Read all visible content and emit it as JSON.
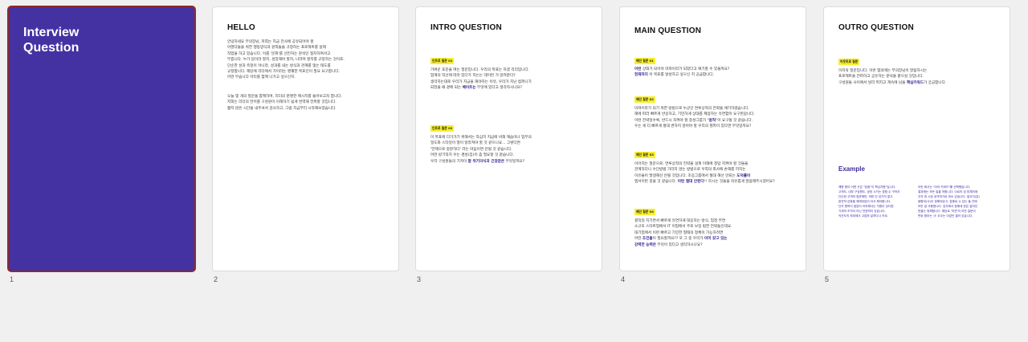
{
  "slides": [
    {
      "number": "1",
      "title_lines": [
        "Interview",
        "Question"
      ]
    },
    {
      "number": "2",
      "title": "HELLO",
      "para1": "안녕하세요 부의장님, 저희는 지금 전사에 공유되어야 할\n아젠다들을 위한 행동양식과 원칙들을 규정하는 프로젝트를 실제\n작업을 하고 있습니다. 이를 '문화'를 선언하는 분석인 접지하여서고\n부릅니다. 누가 답이라 할지, 성장해야 할지, 나라며 할지를 규정하는 것이죠.\n단순한 성과 측정이 아니라, 성과를 내는 방식과 관계를 맺는 태도를\n규정합니다. 해당에 리더에서 가이라는 명쾌한 목표인이 필요 요구합니다.\n어떤 무습니다 아티를 함께 나가고 싶으신지.",
      "para2": "오늘 몇 개의 질문을 함께하며, 리더의 분명한 메시지를 들어보고자 합니다.\n저희는 리더의 언어를 구성원이 이해하기 쉽게 번역해 전파할 것입니다.\n짧지 않은 시간을 내주셔서 감사하고, 그럼 지금부터 시작해보겠습니다."
    },
    {
      "number": "3",
      "title": "INTRO QUESTION",
      "q1_badge": "인트로 질문 01",
      "q1_text_a": "가벼운 포문을 여는 질문입니다. 우리의 목표는 하겠 리더입니다.\n업계의 익선에 따라 있다가 지는는 데이런 거 알려준다?\n생각하는대로 우리가 지금을 해야하는 이유, 우리가 지난 컴퍼니가\n되었을 때 곁에 되는 ",
      "q1_hl": "페이트는",
      "q1_text_b": " 무엇에 있다고 생각하시나요?",
      "q2_badge": "인트로 질문 02",
      "q2_text_a": "이 목표에 다가가기 위해서는 작심히 지금에 비해 해습이나 업무의\n밀도와 스타일이 많이 달라져야 할 것 같으니요... 그렇다면\n'언제으로 중분하다' 라는 마음이면 안될 것 같습니다.\n어떤 방기익지 우는 경성(집)이 좀 필요할 것 같습니다.\n우리 구성원들의 기저이 ",
      "q2_hl": "잘 위기의식과 긴장감은",
      "q2_text_b": " 무엇일까요?"
    },
    {
      "number": "4",
      "title": "MAIN QUESTION",
      "badges": [
        "메인 질문 01",
        "메인 질문 02",
        "메인 질문 03",
        "메인 질문 04"
      ],
      "m1_hl1": "이런",
      "m1_text_a": " 상태가 되어야 미쳐이라가 되었다고 얘기할 수 있을까요?\n",
      "m1_hl2": "현재까지",
      "m1_text_b": " 이 목표를 달성하고 싶으신 지 공급합니다.",
      "m2_text_a": "미쳐이라가 되기 위한 방법으로 누군인 연루상적의 전략을 얘기하셨습니다.\n해에 따라 빠르게 반응하고, 기민하게 상대를 제압하는 유연함이 요구된답니다.\n이런 전략일수록, 반드시 자켜야 할 중성그룹가 \"",
      "m2_hl": "원칙",
      "m2_text_b": "\"이 요구될 것 같습니다.\n우는 게 더 빠르게 절대 변하지 않아야 할 우리의 철학이 있다면 무엇일까요?",
      "m3_text_a": "이어지는 질문으로, 연루상적의 전략을 설계 이해에 정답 지켜야 할 것들을\n관계하다니 수단방법 가리지 않는 방법으로 우희의 회사에 손해를 끼치는\n이유들이 발생해선 안될 것입니다. 조응그룹에서 절대 해선 안되는 ",
      "m3_hl1": "도덕률이",
      "m3_text_b": "\n엠서이런 중을 것 같습니다. ",
      "m3_hl2": "이런 절대 안된다",
      "m3_text_c": "!! 하시는 것들을 자유롭게 말씀해주시겠어요?",
      "m4_text_a": "결직일 지기면서 빠르게 유연하게 대응하는 방식, 엄정 부연\n소규모 스타트업에서 IT 이업에서 주로 보일 법한 전략들인데요.\n대기업에서 이런 빠르고 기민한 형태의 정체이 가능하려면\n어떤 ",
      "m4_hl1": "조건들",
      "m4_text_b": "이 필요할까요?? 또 그 중 우리가 ",
      "m4_hl2": "이미 갖고 있는\n강력한 능력은",
      "m4_text_c": " 무엇이 있다고 생각하시나요?"
    },
    {
      "number": "5",
      "title": "OUTRO QUESTION",
      "badge": "아웃트로 질문",
      "o_text_a": "이지막 질문입니다. 이번 협의에는 부의장님이 말씀하시는\n프로젝트을 전파하고 공유하는 분석을 맡으실 것입니다.\n구성원들 사이에서 널리 퍼지고 계속에 남을 ",
      "o_hl": "핵심키워드",
      "o_text_b": "가 궁금합니다.",
      "example_title": "Example",
      "example_left": "예원 함이 어쩐 곳은 \"집중\"이 핵심지원\"입니다.\n고객도, 내부 구성원도, 공정 시키는 경험 수 구하조\n단순한 고객의 립문에만, 하한 단 담가자 알고\n완전적 감동을 해제되었어 라서 해야합니다.\n단지 협력이 많았어 이어해서는 지원이 당다편\n기계의 조직이 아닌 전장력이 있습니다.\n직관도의 최대에서 고집하 달까다나 카요.",
      "example_right": "이런 회사는 \"아라 키워드\"를 선택했습니다.\n결과에는 모든 일을 허합니다. 이르의 된 방체처에\n숫자 위 시장 공격하기로 위소 있습니다. 일무지(분)\n융합되(사)이 정해야었고, 접종로 수 있는 둘 관에\n모든 걸 사용합니다. 업무에서 정해새 받은 일처인\n빗을는 정해합니다. 해당로 '의견'의 어전 질문이\n판위 합라는 사' 오오는 이었던 결러 있습니다."
    }
  ]
}
